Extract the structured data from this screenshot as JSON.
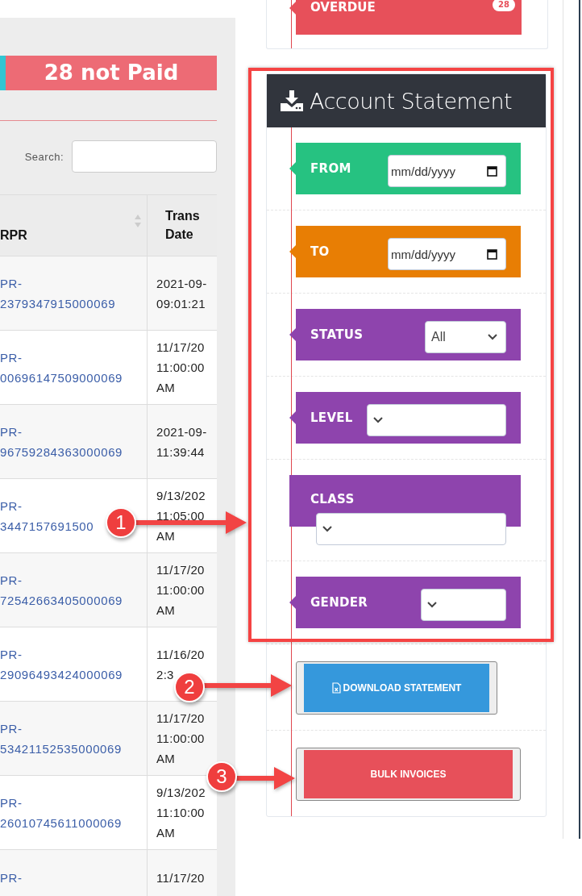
{
  "summary": {
    "label": "28 not Paid"
  },
  "search": {
    "label": "Search:"
  },
  "table": {
    "columns": [
      "RPR",
      "Trans Date"
    ],
    "rows": [
      {
        "id_lines": [
          "PR-",
          "2379347915000069"
        ],
        "date_lines": [
          "2021-09-",
          "09:01:21"
        ]
      },
      {
        "id_lines": [
          "PR-",
          "00696147509000069"
        ],
        "date_lines": [
          "11/17/20",
          "11:00:00",
          "AM"
        ]
      },
      {
        "id_lines": [
          "PR-",
          "96759284363000069"
        ],
        "date_lines": [
          "2021-09-",
          "11:39:44"
        ]
      },
      {
        "id_lines": [
          "PR-",
          "3447157691500"
        ],
        "date_lines": [
          "9/13/202",
          "11:05:00",
          "AM"
        ]
      },
      {
        "id_lines": [
          "PR-",
          "72542663405000069"
        ],
        "date_lines": [
          "11/17/20",
          "11:00:00",
          "AM"
        ]
      },
      {
        "id_lines": [
          "PR-",
          "29096493424000069"
        ],
        "date_lines": [
          "11/16/20",
          "2:3"
        ]
      },
      {
        "id_lines": [
          "PR-",
          "53421152535000069"
        ],
        "date_lines": [
          "11/17/20",
          "11:00:00",
          "AM"
        ]
      },
      {
        "id_lines": [
          "PR-",
          "26010745611000069"
        ],
        "date_lines": [
          "9/13/202",
          "11:10:00",
          "AM"
        ]
      },
      {
        "id_lines": [
          "PR-"
        ],
        "date_lines": [
          "11/17/20"
        ]
      }
    ]
  },
  "overdue": {
    "label": "OVERDUE",
    "count": "28"
  },
  "statement": {
    "title": "Account Statement",
    "filters": [
      {
        "label": "FROM",
        "kind": "date",
        "placeholder": "mm/dd/yyyy",
        "color": "#26c281"
      },
      {
        "label": "TO",
        "kind": "date",
        "placeholder": "mm/dd/yyyy",
        "color": "#e87e04"
      },
      {
        "label": "STATUS",
        "kind": "select",
        "value": "All",
        "color": "#8e44ad"
      },
      {
        "label": "LEVEL",
        "kind": "select",
        "color": "#8e44ad"
      },
      {
        "label": "CLASS",
        "kind": "select-below",
        "color": "#8e44ad"
      },
      {
        "label": "GENDER",
        "kind": "select",
        "color": "#8e44ad"
      }
    ],
    "buttons": [
      {
        "label": "DOWNLOAD STATEMENT",
        "kind": "download"
      },
      {
        "label": "BULK INVOICES",
        "kind": "bulk"
      }
    ]
  },
  "callouts": [
    {
      "number": "1"
    },
    {
      "number": "2"
    },
    {
      "number": "3"
    }
  ]
}
